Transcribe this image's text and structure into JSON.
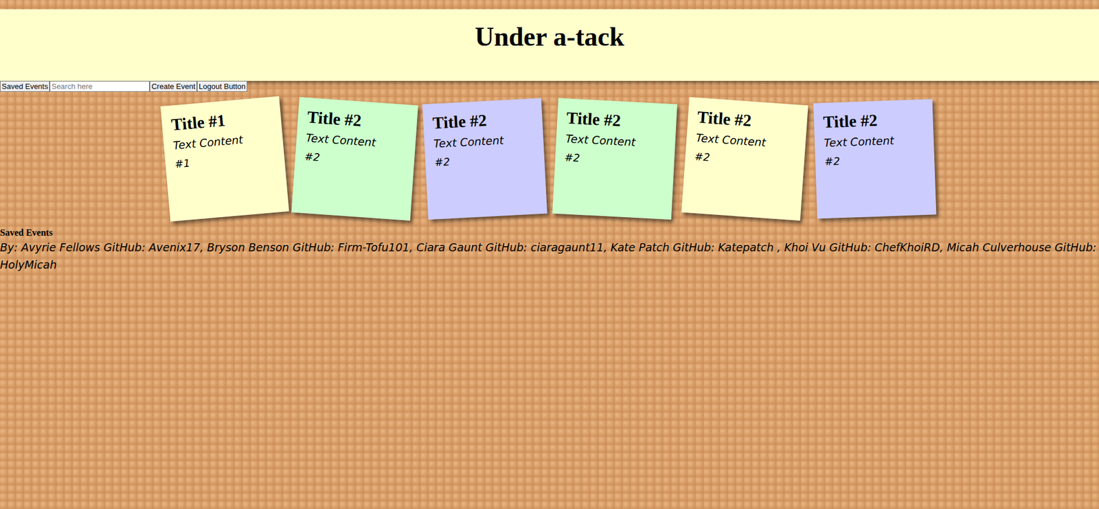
{
  "header": {
    "title": "Under a-tack"
  },
  "toolbar": {
    "buttons": [
      "Saved Events",
      "Create Event",
      "Logout Button"
    ],
    "search": {
      "placeholder": "Search here"
    }
  },
  "notes": [
    {
      "title": "Title #1",
      "content": "Text Content",
      "number": "#1",
      "color": "#ffffcc"
    },
    {
      "title": "Title #2",
      "content": "Text Content",
      "number": "#2",
      "color": "#ccffcc"
    },
    {
      "title": "Title #2",
      "content": "Text Content",
      "number": "#2",
      "color": "#ccccff"
    },
    {
      "title": "Title #2",
      "content": "Text Content",
      "number": "#2",
      "color": "#ccffcc"
    },
    {
      "title": "Title #2",
      "content": "Text Content",
      "number": "#2",
      "color": "#ffffcc"
    },
    {
      "title": "Title #2",
      "content": "Text Content",
      "number": "#2",
      "color": "#ccccff"
    }
  ],
  "saved": {
    "heading": "Saved Events"
  },
  "credits": "By: Avyrie Fellows GitHub: Avenix17, Bryson Benson GitHub: Firm-Tofu101, Ciara Gaunt GitHub: ciaragaunt11, Kate Patch GitHub: Katepatch , Khoi Vu GitHub: ChefKhoiRD, Micah Culverhouse GitHub: HolyMicah"
}
